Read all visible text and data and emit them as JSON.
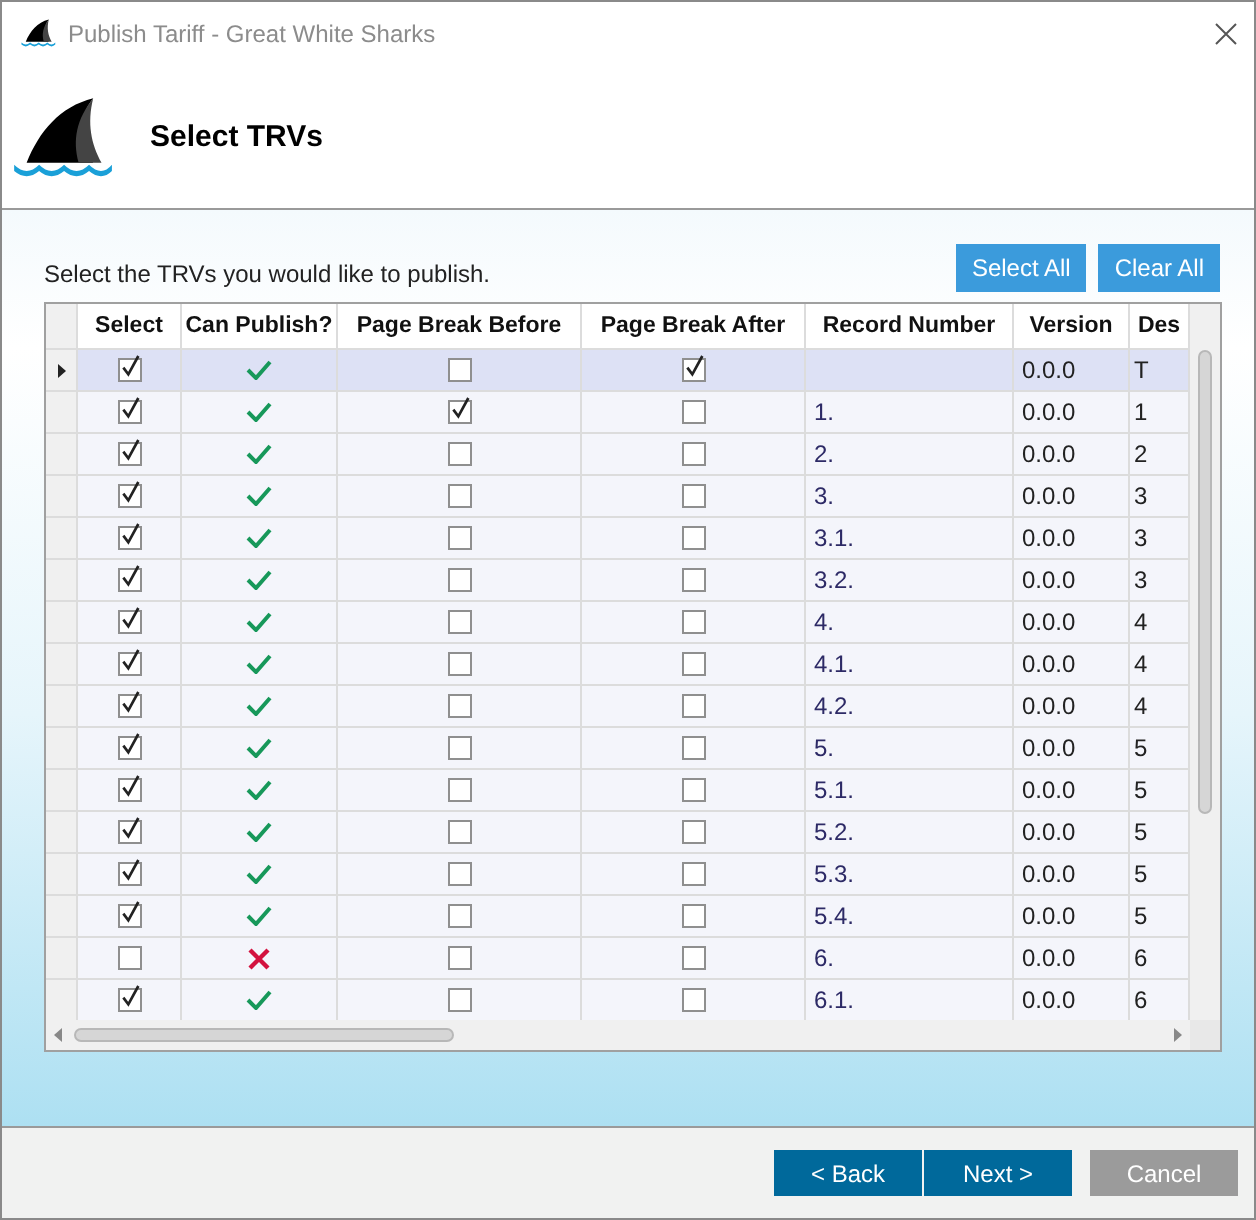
{
  "window": {
    "title": "Publish Tariff - Great White Sharks"
  },
  "header": {
    "title": "Select TRVs"
  },
  "instruction": "Select the TRVs you would like to publish.",
  "actions": [
    "Select All",
    "Clear All"
  ],
  "table": {
    "columns": [
      "Select",
      "Can Publish?",
      "Page Break Before",
      "Page Break After",
      "Record Number",
      "Version",
      "Des"
    ],
    "rows": [
      {
        "selected": true,
        "select": true,
        "can_publish": true,
        "page_break_before": false,
        "page_break_after": true,
        "version": "0.0.0",
        "column_7": "T"
      },
      {
        "selected": false,
        "select": true,
        "can_publish": true,
        "page_break_before": true,
        "page_break_after": false,
        "record_number": "1.",
        "version": "0.0.0",
        "column_7": "1"
      },
      {
        "selected": false,
        "select": true,
        "can_publish": true,
        "page_break_before": false,
        "page_break_after": false,
        "record_number": "2.",
        "version": "0.0.0",
        "column_7": "2"
      },
      {
        "selected": false,
        "select": true,
        "can_publish": true,
        "page_break_before": false,
        "page_break_after": false,
        "record_number": "3.",
        "version": "0.0.0",
        "column_7": "3"
      },
      {
        "selected": false,
        "select": true,
        "can_publish": true,
        "page_break_before": false,
        "page_break_after": false,
        "record_number": "3.1.",
        "version": "0.0.0",
        "column_7": "3"
      },
      {
        "selected": false,
        "select": true,
        "can_publish": true,
        "page_break_before": false,
        "page_break_after": false,
        "record_number": "3.2.",
        "version": "0.0.0",
        "column_7": "3"
      },
      {
        "selected": false,
        "select": true,
        "can_publish": true,
        "page_break_before": false,
        "page_break_after": false,
        "record_number": "4.",
        "version": "0.0.0",
        "column_7": "4"
      },
      {
        "selected": false,
        "select": true,
        "can_publish": true,
        "page_break_before": false,
        "page_break_after": false,
        "record_number": "4.1.",
        "version": "0.0.0",
        "column_7": "4"
      },
      {
        "selected": false,
        "select": true,
        "can_publish": true,
        "page_break_before": false,
        "page_break_after": false,
        "record_number": "4.2.",
        "version": "0.0.0",
        "column_7": "4"
      },
      {
        "selected": false,
        "select": true,
        "can_publish": true,
        "page_break_before": false,
        "page_break_after": false,
        "record_number": "5.",
        "version": "0.0.0",
        "column_7": "5"
      },
      {
        "selected": false,
        "select": true,
        "can_publish": true,
        "page_break_before": false,
        "page_break_after": false,
        "record_number": "5.1.",
        "version": "0.0.0",
        "column_7": "5"
      },
      {
        "selected": false,
        "select": true,
        "can_publish": true,
        "page_break_before": false,
        "page_break_after": false,
        "record_number": "5.2.",
        "version": "0.0.0",
        "column_7": "5"
      },
      {
        "selected": false,
        "select": true,
        "can_publish": true,
        "page_break_before": false,
        "page_break_after": false,
        "record_number": "5.3.",
        "version": "0.0.0",
        "column_7": "5"
      },
      {
        "selected": false,
        "select": true,
        "can_publish": true,
        "page_break_before": false,
        "page_break_after": false,
        "record_number": "5.4.",
        "version": "0.0.0",
        "column_7": "5"
      },
      {
        "selected": false,
        "select": false,
        "can_publish": false,
        "page_break_before": false,
        "page_break_after": false,
        "record_number": "6.",
        "version": "0.0.0",
        "column_7": "6"
      },
      {
        "selected": false,
        "select": true,
        "can_publish": true,
        "page_break_before": false,
        "page_break_after": false,
        "record_number": "6.1.",
        "version": "0.0.0",
        "column_7": "6"
      }
    ]
  },
  "footer_buttons": [
    {
      "label": "< Back",
      "disabled": false
    },
    {
      "label": "Next >",
      "disabled": false
    },
    {
      "label": "Cancel",
      "disabled": true
    }
  ]
}
